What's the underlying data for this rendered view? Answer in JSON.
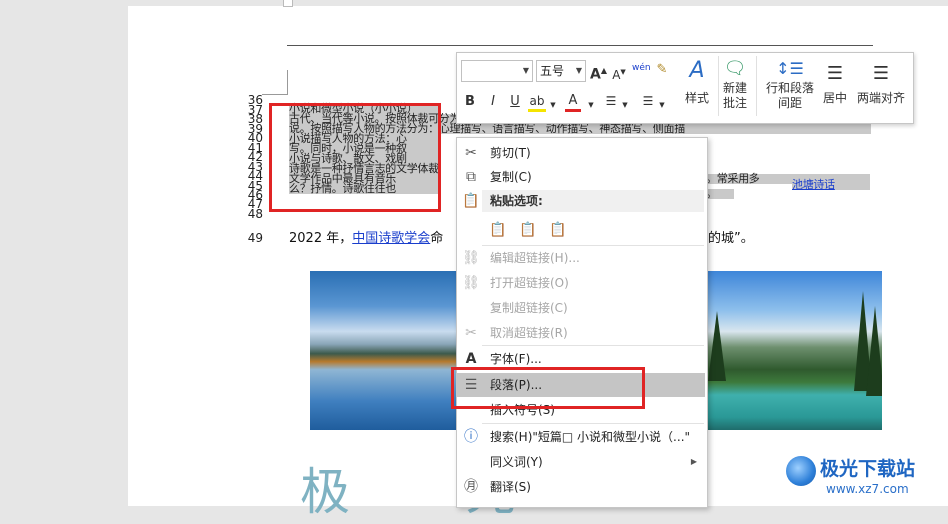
{
  "document": {
    "line_numbers": [
      "36",
      "37",
      "38",
      "39",
      "40",
      "41",
      "42",
      "43",
      "44",
      "45",
      "46",
      "47",
      "48",
      "49"
    ],
    "garbled_lines": [
      "小说和微型小说（小小说）",
      "古代、当代等小说。按照体裁可分为章回体小说、日记体小说、书信体小说、自传体小",
      "说。按照描写人物的方法分为：心理描写、语言描写、动作描写、神态描写、侧面描",
      "小说描写人物的方法：心",
      "写。同时，小说是一种叙",
      "小说与诗歌、散文、戏剧",
      "诗歌是一种抒情言志的文学体裁",
      "文学作品中最具有音乐",
      "么？抒情。诗歌往往也"
    ],
    "line49_prefix": "2022 年，",
    "line49_link": "中国诗歌学会",
    "line49_mid": "命",
    "line49_suffix": "的城”。",
    "right_fragment": "。",
    "right_fragment2": "。常采用多",
    "right_link": "池塘诗话",
    "big_title": "极  光"
  },
  "toolbar": {
    "font_name": "",
    "font_size": "五号",
    "grow_font": "A",
    "shrink_font": "A",
    "phonetic": "wén",
    "bold": "B",
    "italic": "I",
    "underline": "U",
    "highlight_letter": "ab",
    "font_color_letter": "A",
    "styles_label": "样式",
    "new_comment_label": "新建\n批注",
    "new_comment_l1": "新建",
    "new_comment_l2": "批注",
    "line_spacing_l1": "行和段落",
    "line_spacing_l2": "间距",
    "center_label": "居中",
    "justify_label": "两端对齐"
  },
  "context_menu": {
    "items": [
      {
        "label": "剪切(T)",
        "icon": "scissors-icon",
        "enabled": true
      },
      {
        "label": "复制(C)",
        "icon": "copy-icon",
        "enabled": true
      },
      {
        "label": "粘贴选项:",
        "icon": "paste-icon",
        "enabled": true
      },
      {
        "label": "编辑超链接(H)...",
        "icon": "link-edit-icon",
        "enabled": false
      },
      {
        "label": "打开超链接(O)",
        "icon": "link-open-icon",
        "enabled": false
      },
      {
        "label": "复制超链接(C)",
        "icon": "",
        "enabled": false
      },
      {
        "label": "取消超链接(R)",
        "icon": "link-remove-icon",
        "enabled": false
      },
      {
        "label": "字体(F)...",
        "icon": "font-icon",
        "enabled": true
      },
      {
        "label": "段落(P)...",
        "icon": "paragraph-icon",
        "enabled": true
      },
      {
        "label": "插入符号(S)",
        "icon": "",
        "enabled": true
      },
      {
        "label": "搜索(H)\"短篇□ 小说和微型小说（...\"",
        "icon": "search-icon",
        "enabled": true
      },
      {
        "label": "同义词(Y)",
        "icon": "",
        "enabled": true
      },
      {
        "label": "翻译(S)",
        "icon": "translate-icon",
        "enabled": true
      }
    ]
  },
  "watermark": {
    "title": "极光下载站",
    "url": "www.xz7.com"
  },
  "colors": {
    "highlight_red": "#e02424",
    "link_blue": "#1a3ecc",
    "menu_highlight": "#c5c5c5"
  }
}
